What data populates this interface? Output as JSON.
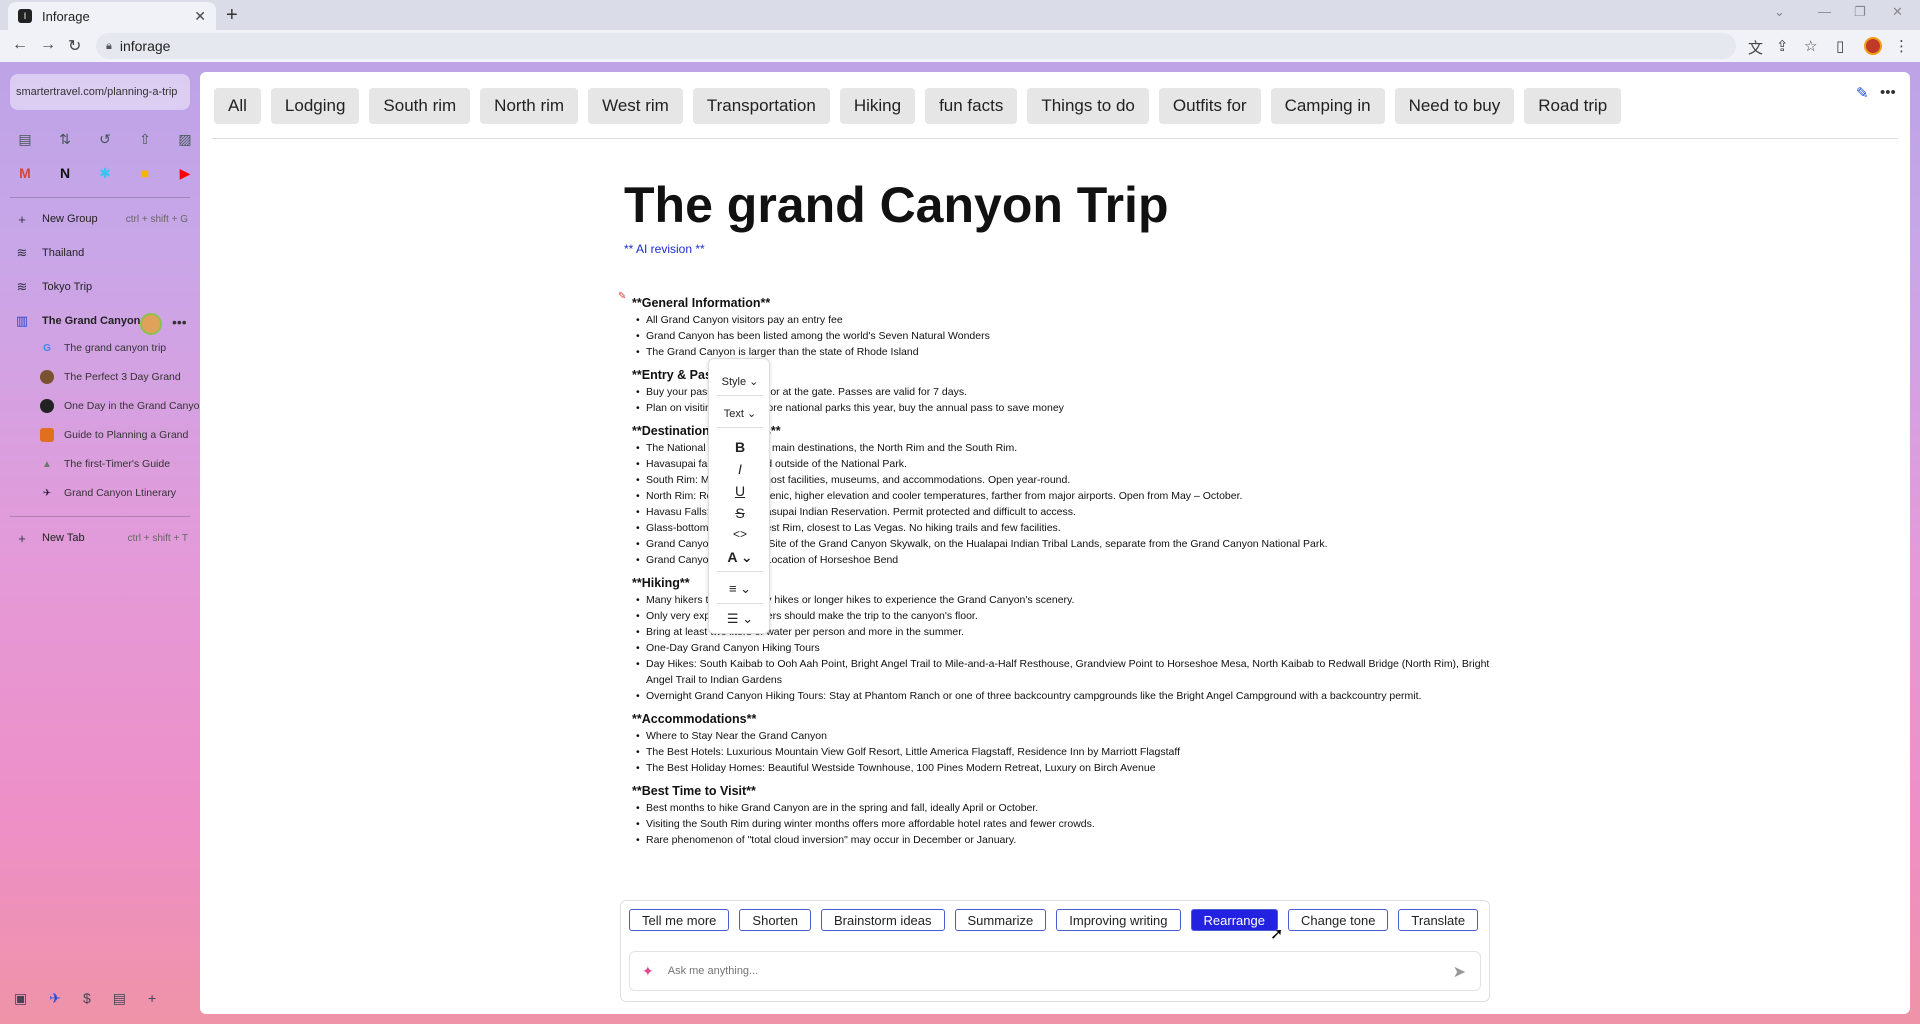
{
  "browser": {
    "tab_title": "Inforage",
    "address": "inforage"
  },
  "sidebar": {
    "url": "smartertravel.com/planning-a-trip",
    "new_group": {
      "label": "New Group",
      "shortcut": "ctrl + shift + G"
    },
    "groups": [
      {
        "label": "Thailand"
      },
      {
        "label": "Tokyo Trip"
      },
      {
        "label": "The Grand Canyon"
      }
    ],
    "tabs": [
      {
        "label": "The grand canyon trip"
      },
      {
        "label": "The Perfect 3 Day Grand"
      },
      {
        "label": "One Day in the Grand Canyon"
      },
      {
        "label": "Guide to Planning a Grand"
      },
      {
        "label": "The first-Timer's Guide"
      },
      {
        "label": "Grand Canyon Ltinerary"
      }
    ],
    "new_tab": {
      "label": "New Tab",
      "shortcut": "ctrl + shift + T"
    }
  },
  "chips": [
    "All",
    "Lodging",
    "South rim",
    "North rim",
    "West rim",
    "Transportation",
    "Hiking",
    "fun facts",
    "Things to do",
    "Outfits for",
    "Camping in",
    "Need to buy",
    "Road trip"
  ],
  "doc": {
    "title": "The grand Canyon Trip",
    "ai_revision": "** AI revision **",
    "sections": [
      {
        "heading": "**General Information**",
        "items": [
          "All Grand Canyon visitors pay an entry fee",
          "Grand Canyon has been listed among the world's Seven Natural Wonders",
          "The Grand Canyon is larger than the state of Rhode Island"
        ]
      },
      {
        "heading": "**Entry & Passes**",
        "items": [
          "Buy your pass online here or at the gate. Passes are valid for 7 days.",
          "Plan on visiting three or more national parks this year, buy the annual pass to save money"
        ]
      },
      {
        "heading": "**Destinations & Sights**",
        "items": [
          "The National Park has two main destinations, the North Rim and the South Rim.",
          "Havasupai falls are located outside of the National Park.",
          "South Rim: Most visited, most facilities, museums, and accommodations. Open year-round.",
          "North Rim: Remote and scenic, higher elevation and cooler temperatures, farther from major airports. Open from May – October.",
          "Havasu Falls: On the Havasupai Indian Reservation. Permit protected and difficult to access.",
          "Glass-bottom Skywalk: West Rim, closest to Las Vegas. No hiking trails and few facilities.",
          "Grand Canyon West Rim: Site of the Grand Canyon Skywalk, on the Hualapai Indian Tribal Lands, separate from the Grand Canyon National Park.",
          "Grand Canyon East Rim: Location of Horseshoe Bend"
        ]
      },
      {
        "heading": "**Hiking**",
        "items": [
          "Many hikers take short day hikes or longer hikes to experience the Grand Canyon's scenery.",
          "Only very experienced hikers should make the trip to the canyon's floor.",
          "Bring at least two liters of water per person and more in the summer.",
          "One-Day Grand Canyon Hiking Tours",
          "Day Hikes: South Kaibab to Ooh Aah Point, Bright Angel Trail to Mile-and-a-Half Resthouse, Grandview Point to Horseshoe Mesa, North Kaibab to Redwall Bridge (North Rim), Bright Angel Trail to Indian Gardens",
          "Overnight Grand Canyon Hiking Tours: Stay at Phantom Ranch or one of three backcountry campgrounds like the Bright Angel Campground with a backcountry permit."
        ]
      },
      {
        "heading": "**Accommodations**",
        "items": [
          "Where to Stay Near the Grand Canyon",
          "The Best Hotels: Luxurious Mountain View Golf Resort, Little America Flagstaff, Residence Inn by Marriott Flagstaff",
          "The Best Holiday Homes: Beautiful Westside Townhouse, 100 Pines Modern Retreat, Luxury on Birch Avenue"
        ]
      },
      {
        "heading": "**Best Time to Visit**",
        "items": [
          "Best months to hike Grand Canyon are in the spring and fall, ideally April or October.",
          "Visiting the South Rim during winter months offers more affordable hotel rates and fewer crowds.",
          "Rare phenomenon of \"total cloud inversion\" may occur in December or January."
        ]
      }
    ]
  },
  "toolbox": {
    "style": "Style",
    "text": "Text",
    "bold": "B",
    "italic": "I",
    "underline": "U",
    "strike": "S",
    "code": "<>",
    "font_color": "A"
  },
  "ai": {
    "buttons": [
      "Tell me more",
      "Shorten",
      "Brainstorm ideas",
      "Summarize",
      "Improving writing",
      "Rearrange",
      "Change tone",
      "Translate"
    ],
    "active": "Rearrange",
    "placeholder": "Ask me anything..."
  },
  "colors": {
    "accent": "#2222e0",
    "ai_link": "#1a2ecc"
  }
}
